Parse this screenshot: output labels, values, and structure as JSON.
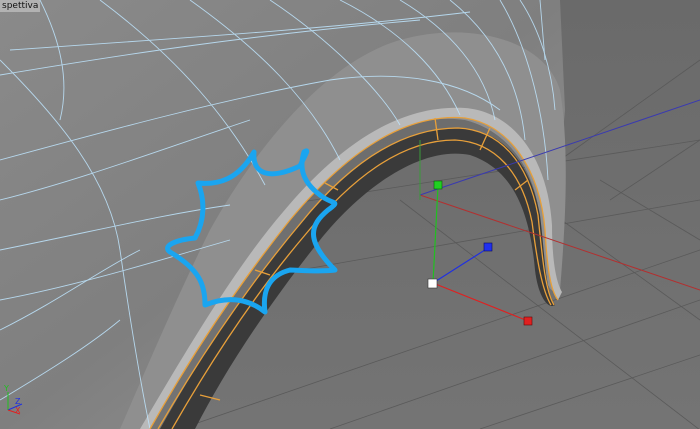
{
  "viewport": {
    "label": "spettiva",
    "background": "#6f6f6f"
  },
  "colors": {
    "mesh_wire": "#bfe6ff",
    "selected_edge": "#e8a03a",
    "annotation": "#1aa5f0",
    "axis_x": "#e02020",
    "axis_y": "#20c020",
    "axis_z": "#2030e0"
  },
  "annotation_icon": "starburst-annotation",
  "axis_gizmo": {
    "y_label": "Y",
    "z_label": "Z",
    "x_label": "X"
  }
}
